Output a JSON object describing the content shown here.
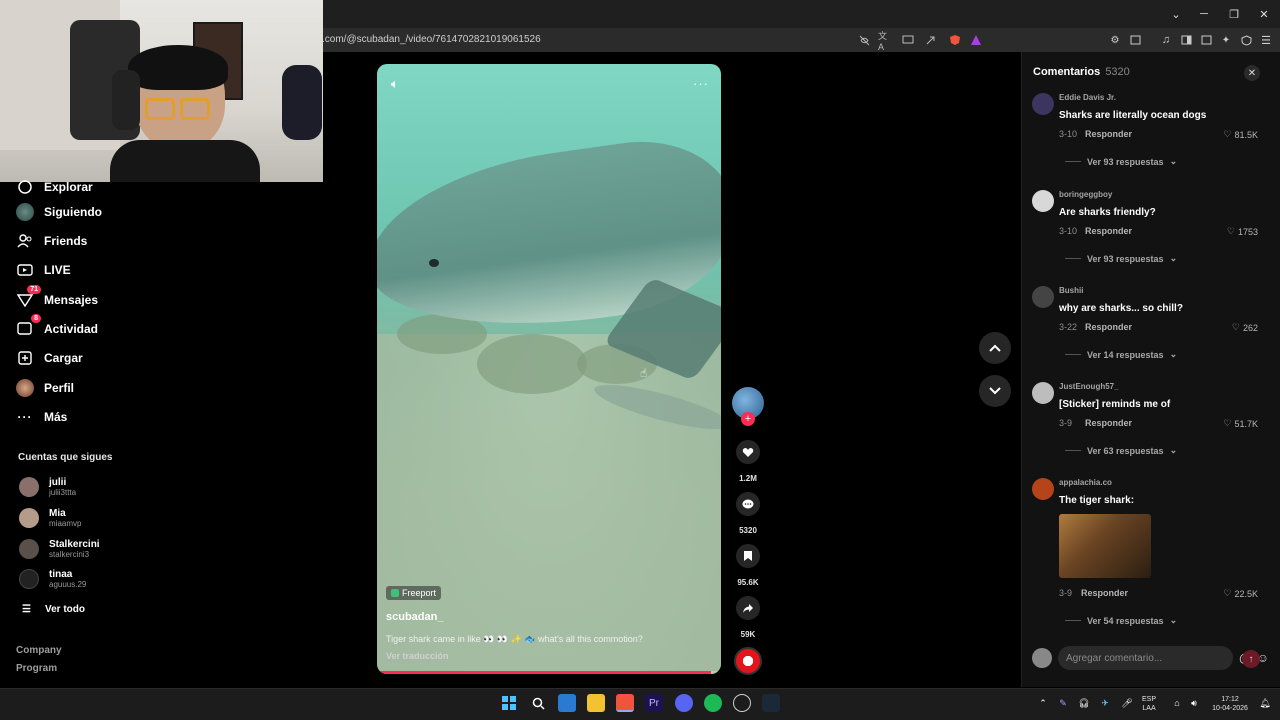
{
  "browser": {
    "url": ".com/@scubadan_/video/7614702821019061526",
    "window_controls": [
      "chevron-down",
      "minimize",
      "restore",
      "close"
    ]
  },
  "sidebar": {
    "items": [
      {
        "label": "Explorar",
        "icon": "compass-icon"
      },
      {
        "label": "Siguiendo",
        "icon": "avatar"
      },
      {
        "label": "Friends",
        "icon": "friends-icon"
      },
      {
        "label": "LIVE",
        "icon": "live-icon"
      },
      {
        "label": "Mensajes",
        "icon": "messages-icon",
        "badge": "71"
      },
      {
        "label": "Actividad",
        "icon": "activity-icon",
        "badge": "8"
      },
      {
        "label": "Cargar",
        "icon": "upload-icon"
      },
      {
        "label": "Perfil",
        "icon": "profile-avatar"
      },
      {
        "label": "Más",
        "icon": "more-icon"
      }
    ],
    "following_title": "Cuentas que sigues",
    "following": [
      {
        "name": "julii",
        "handle": "julii3ttta"
      },
      {
        "name": "Mia",
        "handle": "miaamvp"
      },
      {
        "name": "Stalkercini",
        "handle": "stalkercini3"
      },
      {
        "name": "tinaa",
        "handle": "aguuus.29"
      }
    ],
    "see_all": "Ver todo",
    "footer": [
      "Company",
      "Program"
    ]
  },
  "video": {
    "location": "Freeport",
    "author": "scubadan_",
    "caption": "Tiger shark came in like 👀 👀 ✨ 🐟 what's all this commotion?",
    "translate": "Ver traducción",
    "progress": 0.97
  },
  "actions": {
    "likes": "1.2M",
    "comments": "5320",
    "saves": "95.6K",
    "shares": "59K"
  },
  "comments_panel": {
    "title": "Comentarios",
    "count": "5320",
    "input_placeholder": "Agregar comentario...",
    "items": [
      {
        "user": "Eddie Davis Jr.",
        "text": "Sharks are literally ocean dogs",
        "date": "3-10",
        "reply": "Responder",
        "likes": "81.5K",
        "more": "Ver 93 respuestas"
      },
      {
        "user": "boringeggboy",
        "text": "Are sharks friendly?",
        "date": "3-10",
        "reply": "Responder",
        "likes": "1753",
        "more": "Ver 93 respuestas"
      },
      {
        "user": "Bushii",
        "text": "why are sharks... so chill?",
        "date": "3-22",
        "reply": "Responder",
        "likes": "262",
        "more": "Ver 14 respuestas"
      },
      {
        "user": "JustEnough57_",
        "text": "[Sticker] reminds me of",
        "date": "3-9",
        "reply": "Responder",
        "likes": "51.7K",
        "more": "Ver 63 respuestas"
      },
      {
        "user": "appalachia.co",
        "text": "The tiger shark:",
        "date": "3-9",
        "reply": "Responder",
        "likes": "22.5K",
        "more": "Ver 54 respuestas"
      }
    ]
  },
  "taskbar": {
    "lang": "ESP",
    "lang2": "LAA",
    "time": "17:12",
    "date": "10-04-2026"
  },
  "colors": {
    "accent": "#fe2c55",
    "panel": "#121212",
    "background": "#000000"
  }
}
